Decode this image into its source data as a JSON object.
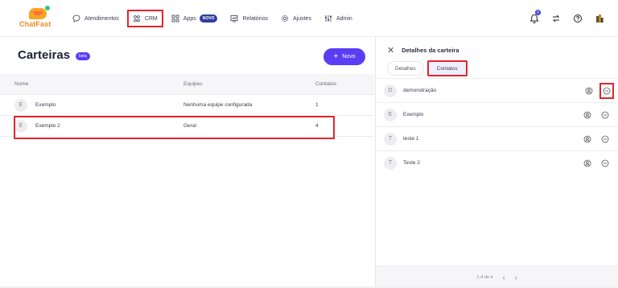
{
  "brand": {
    "name": "ChatFast"
  },
  "nav": {
    "atendimentos": "Atendimentos",
    "crm": "CRM",
    "apps": "Apps",
    "apps_badge": "NOVO",
    "relatorios": "Relatórios",
    "ajustes": "Ajustes",
    "admin": "Admin"
  },
  "top_icons": {
    "notification_count": "8"
  },
  "left": {
    "title": "Carteiras",
    "beta": "beta",
    "new_button": "Novo",
    "columns": {
      "nome": "Nome",
      "equipes": "Equipes",
      "contatos": "Contatos"
    },
    "rows": [
      {
        "initial": "E",
        "name": "Exemplo",
        "equipes": "Nenhuma equipe configurada",
        "contatos": "1"
      },
      {
        "initial": "E",
        "name": "Exemplo 2",
        "equipes": "Geral",
        "contatos": "4"
      }
    ]
  },
  "right": {
    "title": "Detalhes da carteira",
    "tabs": {
      "detalhes": "Detalhes",
      "contatos": "Contatos"
    },
    "contacts": [
      {
        "initial": "D",
        "name": "demonstração"
      },
      {
        "initial": "E",
        "name": "Exemplo"
      },
      {
        "initial": "T",
        "name": "teste 1"
      },
      {
        "initial": "T",
        "name": "Teste 2"
      }
    ],
    "pager": "1-4 de 4"
  },
  "colors": {
    "accent": "#5b3df5",
    "highlight": "#e0262c",
    "brand_orange": "#f08a1c"
  }
}
